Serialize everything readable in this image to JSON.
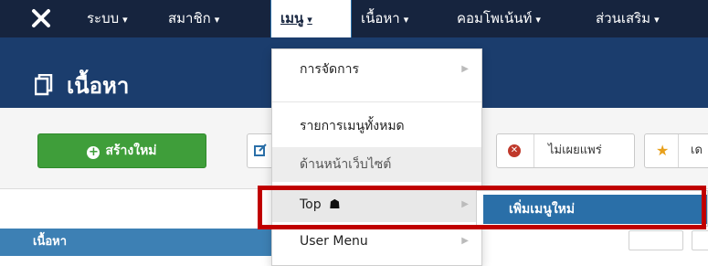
{
  "topnav": {
    "logo_icon": "joomla-logo-icon",
    "items": [
      {
        "label": "ระบบ"
      },
      {
        "label": "สมาชิก"
      },
      {
        "label": "เมนู"
      },
      {
        "label": "เนื้อหา"
      },
      {
        "label": "คอมโพเน้นท์"
      },
      {
        "label": "ส่วนเสริม"
      }
    ],
    "caret": "▾"
  },
  "header": {
    "title": "เนื้อหา",
    "icon": "copy-icon"
  },
  "toolbar": {
    "new_label": "สร้างใหม่",
    "new_icon": "plus-circle-icon",
    "edit_icon": "edit-icon",
    "unpublish_label": "ไม่เผยแพร่",
    "unpublish_icon": "x-circle-icon",
    "featured_label": "เด",
    "featured_icon": "star-icon"
  },
  "sidebar": {
    "heading": "เนื้อหา"
  },
  "menu_dropdown": {
    "items": [
      {
        "label": "การจัดการ",
        "has_submenu": true
      },
      {
        "label": "รายการเมนูทั้งหมด",
        "has_submenu": false
      },
      {
        "label": "ด้านหน้าเว็บไซต์",
        "has_submenu": false
      },
      {
        "label": "Top",
        "icon": "home-icon",
        "has_submenu": true
      },
      {
        "label": "User Menu",
        "has_submenu": true
      }
    ],
    "submenu_arrow": "▶",
    "home_glyph": "☗"
  },
  "submenu": {
    "item_label": "เพิ่มเมนูใหม่"
  },
  "colors": {
    "topnav_bg": "#16243e",
    "header_bg": "#1b3d6d",
    "new_button": "#3f9e3a",
    "submenu_active": "#2a6fa8",
    "annotation_box": "#c00000"
  }
}
